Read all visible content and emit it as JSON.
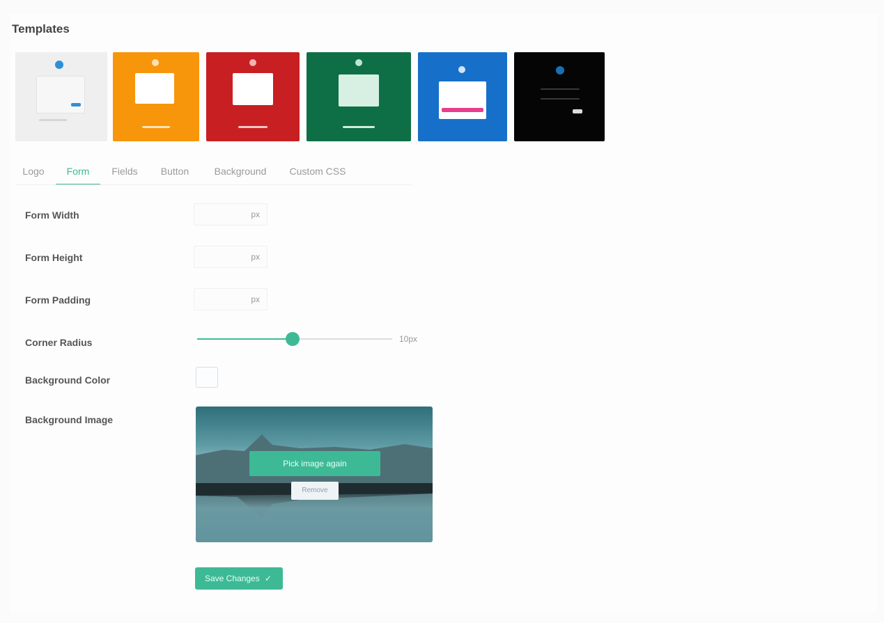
{
  "header": {
    "title": "Templates"
  },
  "templates": [
    {
      "name": "light",
      "bg": "#efefef",
      "accent": "#2f8fd6"
    },
    {
      "name": "orange",
      "bg": "#f7960b",
      "accent": "#ffffff"
    },
    {
      "name": "red",
      "bg": "#c81f22",
      "accent": "#ffffff"
    },
    {
      "name": "green",
      "bg": "#0e6f46",
      "accent": "#ffffff"
    },
    {
      "name": "blue",
      "bg": "#1670c9",
      "accent": "#e83e8c"
    },
    {
      "name": "black",
      "bg": "#050505",
      "accent": "#1a6fb3"
    }
  ],
  "tabs": [
    {
      "label": "Logo"
    },
    {
      "label": "Form",
      "active": true
    },
    {
      "label": "Fields"
    },
    {
      "label": "Button"
    },
    {
      "label": "Background"
    },
    {
      "label": "Custom CSS"
    }
  ],
  "form": {
    "width_label": "Form Width",
    "width_unit": "px",
    "height_label": "Form Height",
    "height_unit": "px",
    "padding_label": "Form Padding",
    "padding_unit": "px",
    "radius_label": "Corner Radius",
    "radius_value": "10px",
    "radius_fraction": 0.49,
    "bg_color_label": "Background Color",
    "bg_image_label": "Background Image",
    "pick_button": "Pick image again",
    "remove_button": "Remove",
    "save_button": "Save Changes",
    "save_icon": "check-icon"
  },
  "colors": {
    "accent": "#3dba95"
  }
}
